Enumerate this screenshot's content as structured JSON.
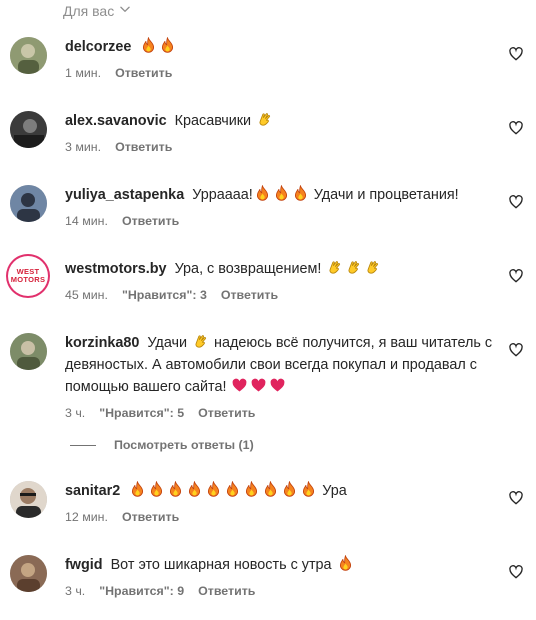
{
  "filter": {
    "label": "Для вас"
  },
  "comments": [
    {
      "username": "delcorzee",
      "text": "",
      "emojis": [
        "fire",
        "fire"
      ],
      "time": "1 мин.",
      "likes": "",
      "reply": "Ответить",
      "avatar": {
        "kind": "photo",
        "colors": [
          "#8f9a72",
          "#c9c6a8"
        ]
      }
    },
    {
      "username": "alex.savanovic",
      "text": "Красавчики",
      "emojis": [
        "clap"
      ],
      "time": "3 мин.",
      "likes": "",
      "reply": "Ответить",
      "avatar": {
        "kind": "photo",
        "colors": [
          "#2c2c2c",
          "#6a6a6a"
        ]
      }
    },
    {
      "username": "yuliya_astapenka",
      "text_before": "Урраааа!",
      "emojis": [
        "fire",
        "fire",
        "fire"
      ],
      "text_after": "Удачи и процветания!",
      "time": "14 мин.",
      "likes": "",
      "reply": "Ответить",
      "avatar": {
        "kind": "photo",
        "colors": [
          "#6f86a4",
          "#2d3544"
        ]
      }
    },
    {
      "username": "westmotors.by",
      "text": "Ура, с возвращением!",
      "emojis": [
        "clap",
        "clap",
        "clap"
      ],
      "time": "45 мин.",
      "likes": "\"Нравится\": 3",
      "reply": "Ответить",
      "avatar": {
        "kind": "brand",
        "text_top": "WEST",
        "text_bottom": "MOTORS"
      }
    },
    {
      "username": "korzinka80",
      "text_before": "Удачи",
      "emojis_inline": [
        "clap"
      ],
      "text_after": "надеюсь всё получится, я ваш читатель с девяностых. А автомобили свои всегда покупал и продавал с помощью вашего сайта!",
      "emojis": [
        "heart",
        "heart",
        "heart"
      ],
      "time": "3 ч.",
      "likes": "\"Нравится\": 5",
      "reply": "Ответить",
      "avatar": {
        "kind": "photo",
        "colors": [
          "#7d8c68",
          "#c9c0a6"
        ]
      }
    },
    {
      "username": "sanitar2",
      "text": "",
      "emojis": [
        "fire",
        "fire",
        "fire",
        "fire",
        "fire",
        "fire",
        "fire",
        "fire",
        "fire",
        "fire"
      ],
      "text_after": "Ура",
      "time": "12 мин.",
      "likes": "",
      "reply": "Ответить",
      "avatar": {
        "kind": "photo",
        "colors": [
          "#e0d7cc",
          "#2a2a2a"
        ]
      }
    },
    {
      "username": "fwgid",
      "text": "Вот это шикарная новость с утра",
      "emojis": [
        "fire"
      ],
      "time": "3 ч.",
      "likes": "\"Нравится\": 9",
      "reply": "Ответить",
      "avatar": {
        "kind": "photo",
        "colors": [
          "#8a6a55",
          "#c4a583"
        ]
      }
    }
  ],
  "view_replies": {
    "label": "Посмотреть ответы (1)"
  },
  "colors": {
    "text": "#262626",
    "meta": "#737373",
    "fire": "#f5821f",
    "heart_emoji": "#e0245e"
  }
}
